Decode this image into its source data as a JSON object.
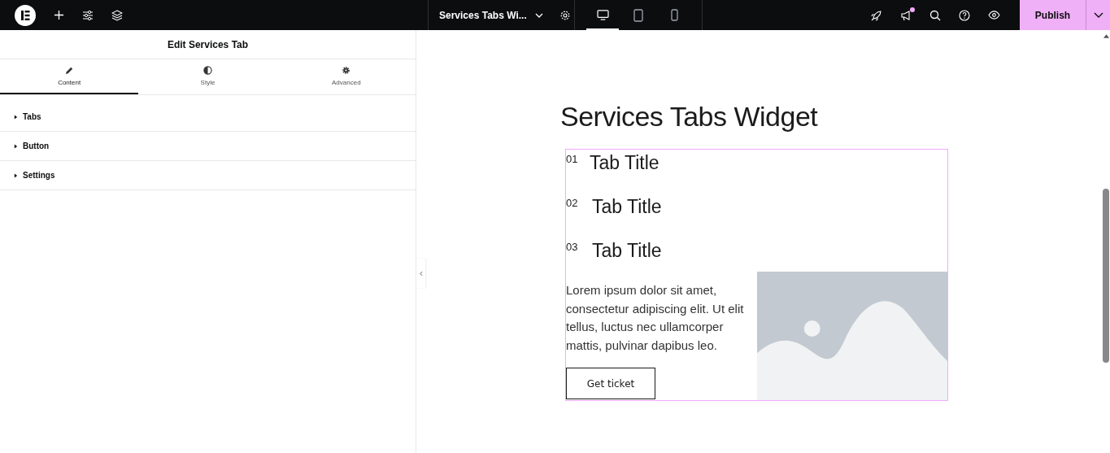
{
  "topbar": {
    "document_title": "Services Tabs Wi...",
    "devices": [
      {
        "kind": "desktop",
        "selected": true
      },
      {
        "kind": "tablet",
        "selected": false
      },
      {
        "kind": "mobile",
        "selected": false
      }
    ],
    "notification": true,
    "publish": "Publish"
  },
  "panel": {
    "title": "Edit Services Tab",
    "tabs": [
      {
        "label": "Content",
        "kind": "pencil",
        "selected": true
      },
      {
        "label": "Style",
        "kind": "contrast",
        "selected": false
      },
      {
        "label": "Advanced",
        "kind": "gear",
        "selected": false
      }
    ],
    "sections": [
      {
        "label": "Tabs",
        "expanded": false
      },
      {
        "label": "Button",
        "expanded": false
      },
      {
        "label": "Settings",
        "expanded": false
      }
    ]
  },
  "canvas": {
    "heading": "Services Tabs Widget",
    "tabs": [
      {
        "number": "01",
        "title": "Tab Title"
      },
      {
        "number": "02",
        "title": "Tab Title"
      },
      {
        "number": "03",
        "title": "Tab Title"
      }
    ],
    "body": "Lorem ipsum dolor sit amet, consectetur adipiscing elit. Ut elit tellus, luctus nec ullamcorper mattis, pulvinar dapibus leo.",
    "button": "Get ticket"
  }
}
